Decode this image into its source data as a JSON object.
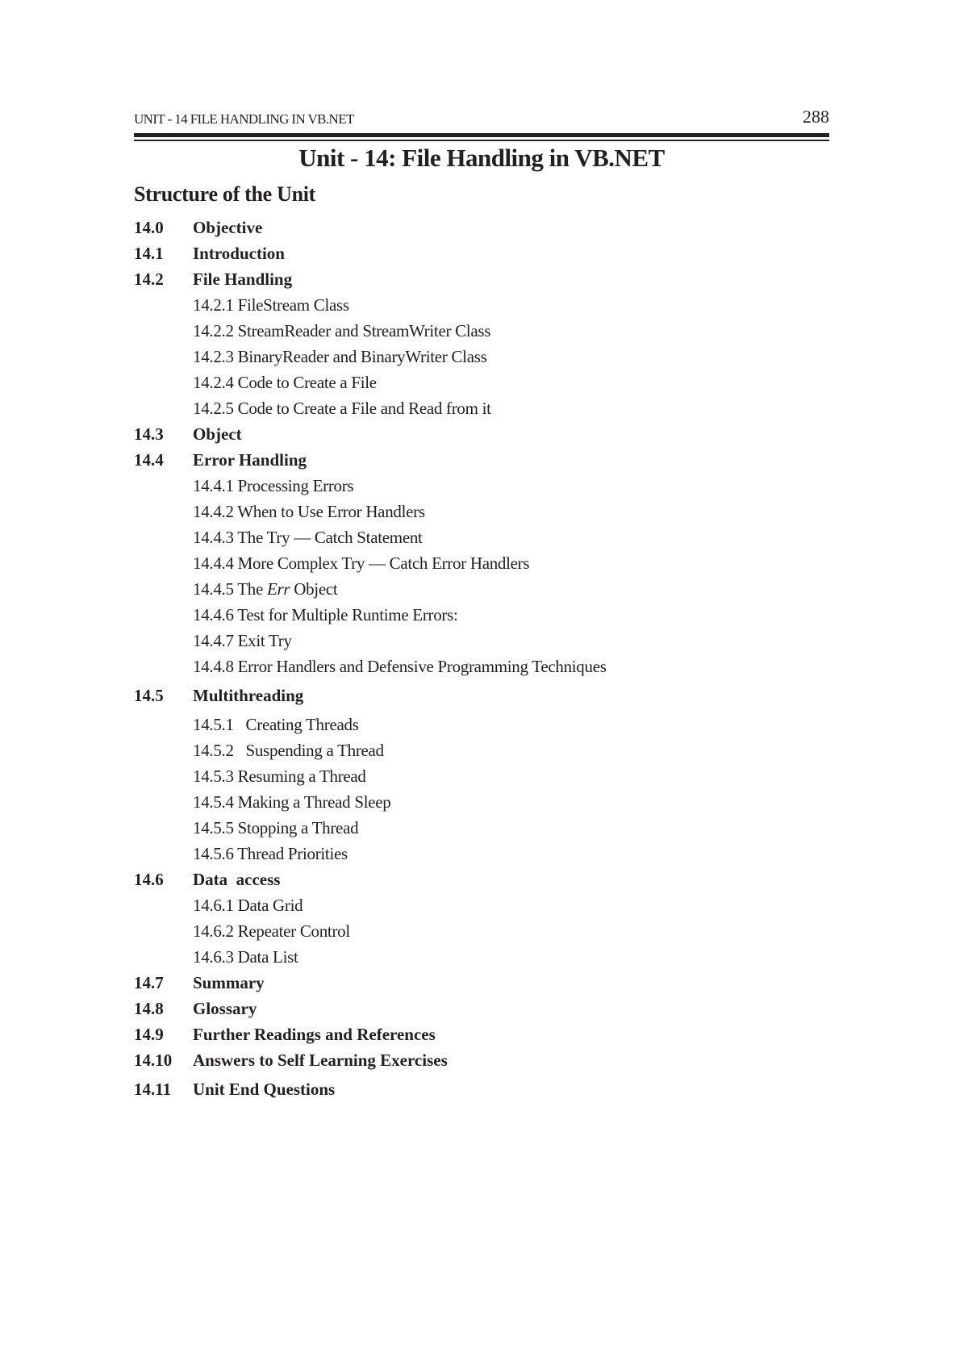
{
  "running_head": {
    "title": "UNIT - 14 FILE HANDLING IN VB.NET",
    "page_number": "288"
  },
  "unit_title": "Unit - 14: File Handling in VB.NET",
  "structure_heading": "Structure of the Unit",
  "toc": [
    {
      "num": "14.0",
      "label": "Objective"
    },
    {
      "num": "14.1",
      "label": "Introduction"
    },
    {
      "num": "14.2",
      "label": "File Handling"
    },
    {
      "sub": "14.2.1 FileStream Class"
    },
    {
      "sub": "14.2.2 StreamReader and StreamWriter Class"
    },
    {
      "sub": "14.2.3 BinaryReader and BinaryWriter Class"
    },
    {
      "sub": "14.2.4 Code to Create a File"
    },
    {
      "sub": "14.2.5 Code to Create a File and Read from it"
    },
    {
      "num": "14.3",
      "label": "Object"
    },
    {
      "num": "14.4",
      "label": "Error Handling"
    },
    {
      "sub": "14.4.1 Processing Errors"
    },
    {
      "sub": "14.4.2 When to Use Error Handlers"
    },
    {
      "sub": "14.4.3 The Try — Catch Statement"
    },
    {
      "sub": "14.4.4 More Complex Try — Catch Error Handlers"
    },
    {
      "sub_prefix": "14.4.5 The ",
      "sub_italic": "Err",
      "sub_suffix": " Object"
    },
    {
      "sub": "14.4.6 Test for Multiple Runtime Errors:"
    },
    {
      "sub": "14.4.7 Exit Try"
    },
    {
      "sub": "14.4.8 Error Handlers and Defensive Programming Techniques"
    },
    {
      "num": "14.5",
      "label": "Multithreading"
    },
    {
      "sub": "14.5.1   Creating Threads"
    },
    {
      "sub": "14.5.2   Suspending a Thread"
    },
    {
      "sub": "14.5.3 Resuming a Thread"
    },
    {
      "sub": "14.5.4 Making a Thread Sleep"
    },
    {
      "sub": "14.5.5 Stopping a Thread"
    },
    {
      "sub": "14.5.6 Thread Priorities"
    },
    {
      "num": "14.6",
      "label": "Data  access"
    },
    {
      "sub": "14.6.1 Data Grid"
    },
    {
      "sub": "14.6.2 Repeater Control"
    },
    {
      "sub": "14.6.3 Data List"
    },
    {
      "num": "14.7",
      "label": "Summary"
    },
    {
      "num": "14.8",
      "label": "Glossary"
    },
    {
      "num": "14.9",
      "label": "Further Readings and References"
    },
    {
      "num": "14.10",
      "label": "Answers to Self Learning Exercises"
    },
    {
      "num": "14.11",
      "label": "Unit End Questions"
    }
  ]
}
